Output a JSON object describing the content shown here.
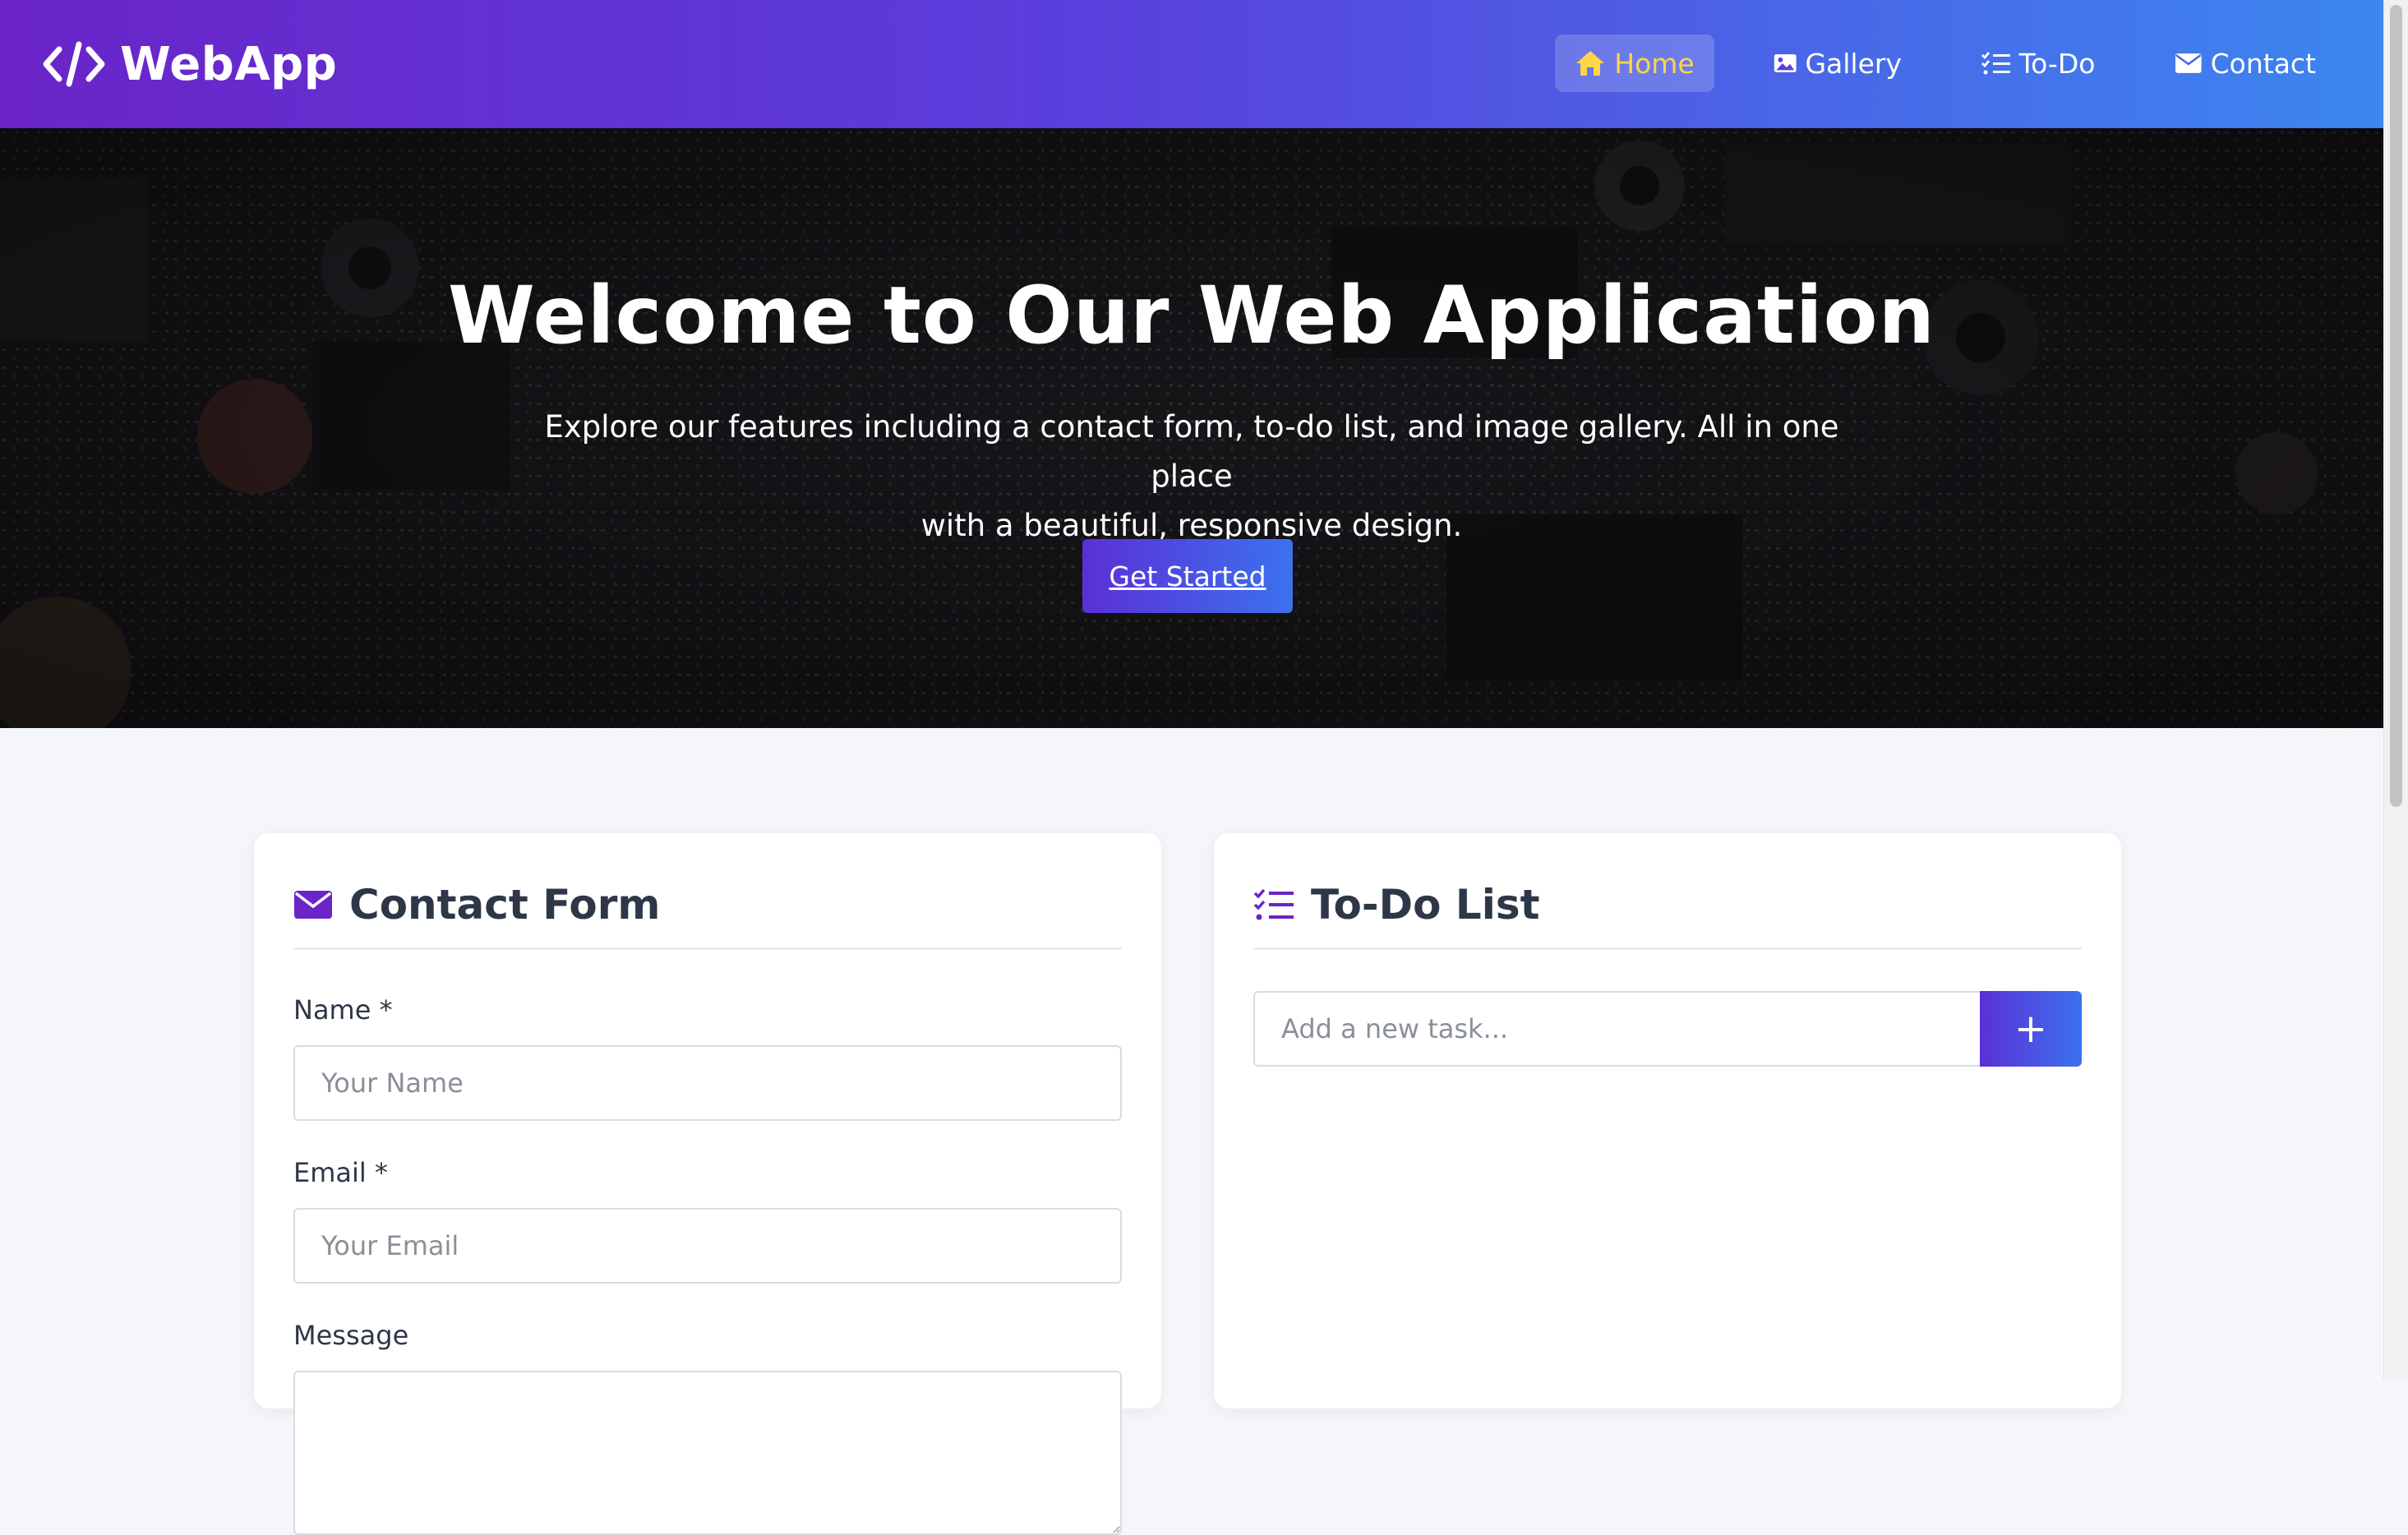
{
  "brand": {
    "name": "WebApp",
    "icon": "code-icon"
  },
  "nav": {
    "items": [
      {
        "label": "Home",
        "icon": "home-icon",
        "active": true
      },
      {
        "label": "Gallery",
        "icon": "image-icon",
        "active": false
      },
      {
        "label": "To-Do",
        "icon": "checklist-icon",
        "active": false
      },
      {
        "label": "Contact",
        "icon": "envelope-icon",
        "active": false
      }
    ]
  },
  "hero": {
    "title": "Welcome to Our Web Application",
    "subtitle_line1": "Explore our features including a contact form, to-do list, and image gallery. All in one place",
    "subtitle_line2": "with a beautiful, responsive design.",
    "cta_label": "Get Started"
  },
  "contact_form": {
    "title": "Contact Form",
    "icon": "envelope-icon",
    "name_label": "Name *",
    "name_placeholder": "Your Name",
    "email_label": "Email *",
    "email_placeholder": "Your Email",
    "message_label": "Message"
  },
  "todo": {
    "title": "To-Do List",
    "icon": "checklist-icon",
    "input_placeholder": "Add a new task...",
    "add_label": "+"
  },
  "colors": {
    "accent_purple": "#6a24c8",
    "accent_blue": "#3c86f0",
    "active_nav_text": "#ffd54a",
    "page_background": "#f4f6fa"
  }
}
